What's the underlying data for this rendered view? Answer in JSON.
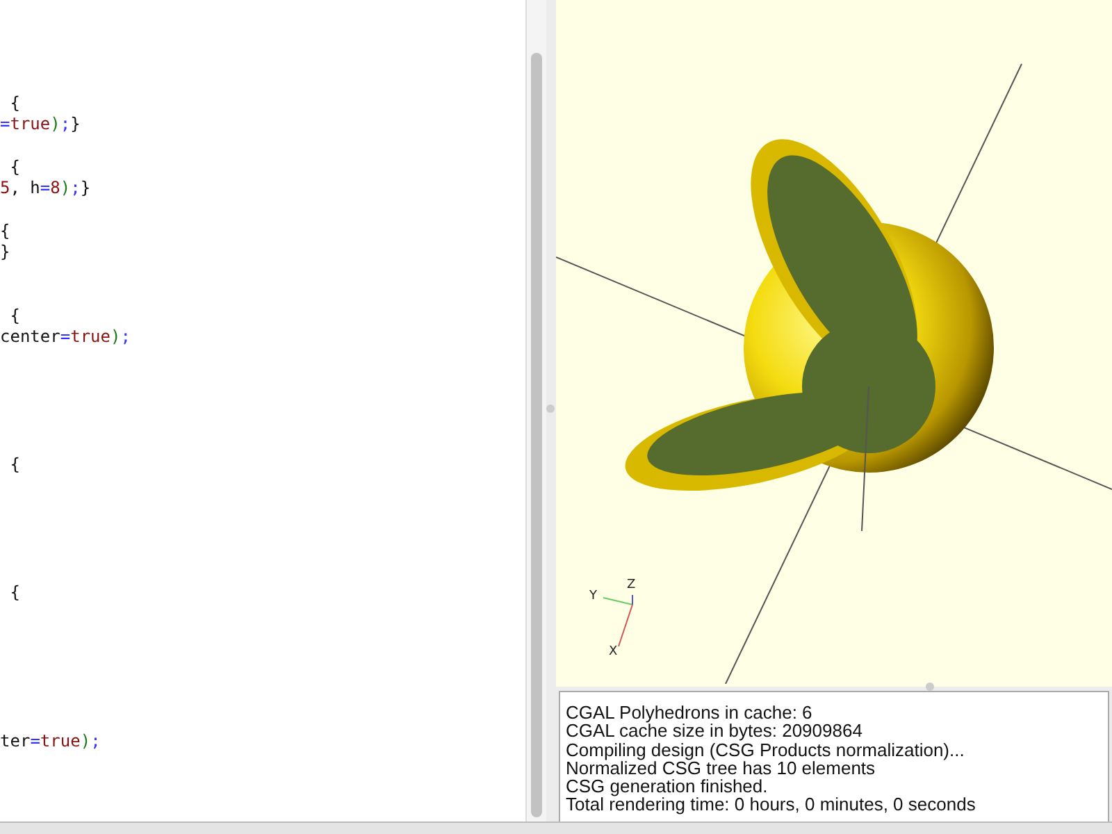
{
  "editor": {
    "lines": [
      {
        "kind": "code",
        "tokens": [
          {
            "kind": "plain",
            "s": " {"
          }
        ]
      },
      {
        "kind": "code",
        "tokens": [
          {
            "kind": "op",
            "s": "="
          },
          {
            "kind": "value",
            "s": "true"
          },
          {
            "kind": "paren",
            "s": ")"
          },
          {
            "kind": "op",
            "s": ";"
          },
          {
            "kind": "plain",
            "s": "}"
          }
        ]
      },
      {
        "kind": "blank"
      },
      {
        "kind": "code",
        "tokens": [
          {
            "kind": "plain",
            "s": " {"
          }
        ]
      },
      {
        "kind": "code",
        "tokens": [
          {
            "kind": "value",
            "s": "5"
          },
          {
            "kind": "plain",
            "s": ", h"
          },
          {
            "kind": "op",
            "s": "="
          },
          {
            "kind": "value",
            "s": "8"
          },
          {
            "kind": "paren",
            "s": ")"
          },
          {
            "kind": "op",
            "s": ";"
          },
          {
            "kind": "plain",
            "s": "}"
          }
        ]
      },
      {
        "kind": "blank"
      },
      {
        "kind": "code",
        "tokens": [
          {
            "kind": "plain",
            "s": "{"
          }
        ]
      },
      {
        "kind": "code",
        "tokens": [
          {
            "kind": "plain",
            "s": "}"
          }
        ]
      },
      {
        "kind": "blank"
      },
      {
        "kind": "blank"
      },
      {
        "kind": "code",
        "tokens": [
          {
            "kind": "plain",
            "s": " {"
          }
        ]
      },
      {
        "kind": "code",
        "tokens": [
          {
            "kind": "plain",
            "s": "center"
          },
          {
            "kind": "op",
            "s": "="
          },
          {
            "kind": "value",
            "s": "true"
          },
          {
            "kind": "paren",
            "s": ")"
          },
          {
            "kind": "op",
            "s": ";"
          }
        ]
      },
      {
        "kind": "blank"
      },
      {
        "kind": "blank"
      },
      {
        "kind": "blank"
      },
      {
        "kind": "blank"
      },
      {
        "kind": "blank"
      },
      {
        "kind": "code",
        "tokens": [
          {
            "kind": "plain",
            "s": " {"
          }
        ]
      },
      {
        "kind": "blank"
      },
      {
        "kind": "blank"
      },
      {
        "kind": "blank"
      },
      {
        "kind": "blank"
      },
      {
        "kind": "blank"
      },
      {
        "kind": "code",
        "tokens": [
          {
            "kind": "plain",
            "s": " {"
          }
        ]
      },
      {
        "kind": "blank"
      },
      {
        "kind": "blank"
      },
      {
        "kind": "blank"
      },
      {
        "kind": "blank"
      },
      {
        "kind": "blank"
      },
      {
        "kind": "blank"
      },
      {
        "kind": "code",
        "tokens": [
          {
            "kind": "plain",
            "s": "ter"
          },
          {
            "kind": "op",
            "s": "="
          },
          {
            "kind": "value",
            "s": "true"
          },
          {
            "kind": "paren",
            "s": ")"
          },
          {
            "kind": "op",
            "s": ";"
          }
        ]
      }
    ]
  },
  "viewport": {
    "axis_labels": [
      "Y",
      "Z",
      "X"
    ]
  },
  "console": {
    "lines": [
      "CGAL Polyhedrons in cache: 6",
      "CGAL cache size in bytes: 20909864",
      "Compiling design (CSG Products normalization)...",
      "Normalized CSG tree has 10 elements",
      "CSG generation finished.",
      "Total rendering time: 0 hours, 0 minutes, 0 seconds"
    ]
  }
}
